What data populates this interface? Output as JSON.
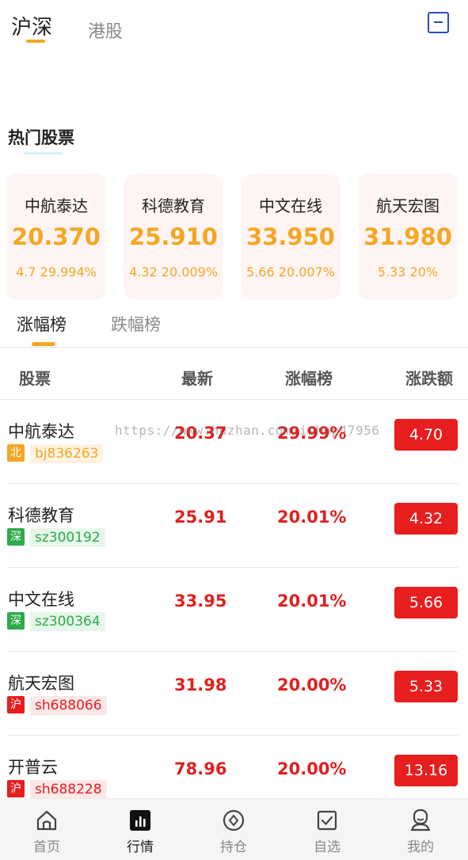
{
  "market_tabs": [
    {
      "label": "沪深",
      "active": true
    },
    {
      "label": "港股",
      "active": false
    }
  ],
  "hot": {
    "title": "热门股票",
    "cards": [
      {
        "name": "中航泰达",
        "price": "20.370",
        "change": "4.7 29.994%"
      },
      {
        "name": "科德教育",
        "price": "25.910",
        "change": "4.32 20.009%"
      },
      {
        "name": "中文在线",
        "price": "33.950",
        "change": "5.66 20.007%"
      },
      {
        "name": "航天宏图",
        "price": "31.980",
        "change": "5.33 20%"
      }
    ]
  },
  "rank_tabs": [
    {
      "label": "涨幅榜",
      "active": true
    },
    {
      "label": "跌幅榜",
      "active": false
    }
  ],
  "table": {
    "headers": {
      "name": "股票",
      "latest": "最新",
      "pct": "涨幅榜",
      "amount": "涨跌额"
    },
    "rows": [
      {
        "name": "中航泰达",
        "market": "北",
        "code": "bj836263",
        "latest": "20.37",
        "pct": "29.99%",
        "amount": "4.70"
      },
      {
        "name": "科德教育",
        "market": "深",
        "code": "sz300192",
        "latest": "25.91",
        "pct": "20.01%",
        "amount": "4.32"
      },
      {
        "name": "中文在线",
        "market": "深",
        "code": "sz300364",
        "latest": "33.95",
        "pct": "20.01%",
        "amount": "5.66"
      },
      {
        "name": "航天宏图",
        "market": "沪",
        "code": "sh688066",
        "latest": "31.98",
        "pct": "20.00%",
        "amount": "5.33"
      },
      {
        "name": "开普云",
        "market": "沪",
        "code": "sh688228",
        "latest": "78.96",
        "pct": "20.00%",
        "amount": "13.16"
      }
    ]
  },
  "watermark": "https://www.huzhan.com/ishop47956",
  "bottom_nav": [
    {
      "label": "首页",
      "icon": "home-icon",
      "active": false
    },
    {
      "label": "行情",
      "icon": "market-chart-icon",
      "active": true
    },
    {
      "label": "持仓",
      "icon": "position-icon",
      "active": false
    },
    {
      "label": "自选",
      "icon": "checkbox-icon",
      "active": false
    },
    {
      "label": "我的",
      "icon": "profile-icon",
      "active": false
    }
  ],
  "colors": {
    "accent_orange": "#f5a623",
    "up_red": "#e61e1e",
    "market_bei": "#f5a623",
    "market_shen": "#2eaa4a",
    "market_hu": "#e61e1e"
  }
}
